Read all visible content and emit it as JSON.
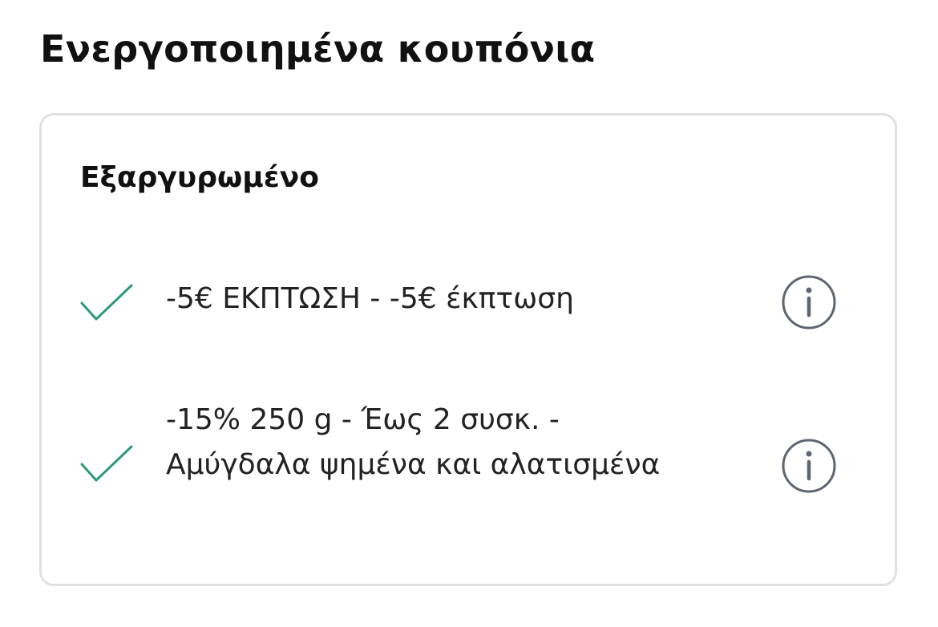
{
  "page": {
    "title": "Ενεργοποιημένα κουπόνια"
  },
  "card": {
    "status": "Εξαργυρωμένο",
    "coupons": [
      {
        "text": "-5€ ΕΚΠΤΩΣΗ - -5€ έκπτωση",
        "status_icon": "check-icon",
        "action_icon": "info-icon"
      },
      {
        "text": "-15% 250 g - Έως 2 συσκ.  - Αμύγδαλα ψημένα και αλατισμένα",
        "status_icon": "check-icon",
        "action_icon": "info-icon"
      }
    ]
  },
  "colors": {
    "check": "#2e9a72",
    "info": "#5f6670",
    "border": "#e1e1e1",
    "text": "#111111"
  }
}
